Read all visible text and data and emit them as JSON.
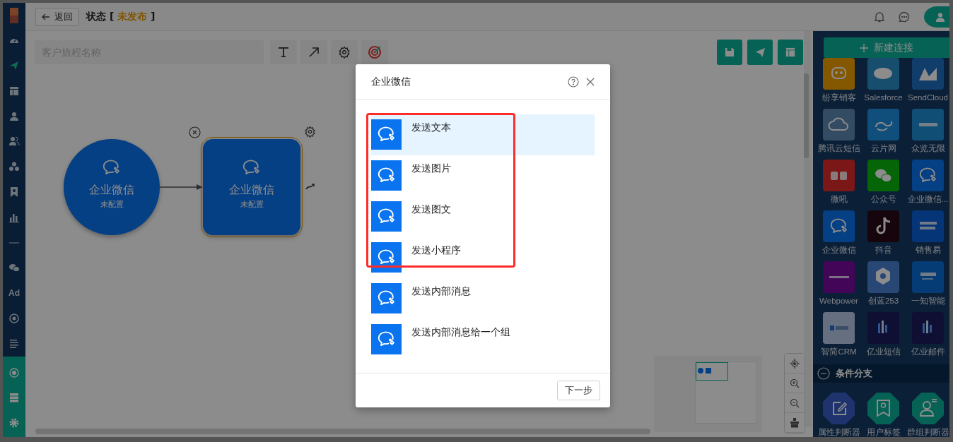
{
  "top_bar": {
    "back_button": "返回",
    "status_label": "状态",
    "bracket_open": "[",
    "status_value": "未发布",
    "bracket_close": "]"
  },
  "left_nav": {
    "top_items": [
      {
        "selected": false
      },
      {
        "selected": true
      },
      {
        "selected": false
      },
      {
        "selected": false
      },
      {
        "selected": false
      },
      {
        "selected": false
      },
      {
        "selected": false
      },
      {
        "selected": false
      },
      {
        "selected": false
      },
      {
        "selected": false
      },
      {
        "selected": false,
        "label": "Ad"
      },
      {
        "selected": false
      },
      {
        "selected": false
      }
    ],
    "bottom_items": [
      {
        "selected": false
      },
      {
        "selected": false
      },
      {
        "selected": false
      }
    ]
  },
  "toolbar": {
    "name_field": {
      "placeholder": "客户旅程名称"
    }
  },
  "canvas": {
    "nodes": [
      {
        "kind": "circle",
        "title": "企业微信",
        "subtitle": "未配置",
        "selected": false
      },
      {
        "kind": "square",
        "title": "企业微信",
        "subtitle": "未配置",
        "selected": true
      }
    ]
  },
  "right_panel": {
    "new_connection_button": "新建连接",
    "apps": [
      {
        "name": "纷享销客"
      },
      {
        "name": "Salesforce"
      },
      {
        "name": "SendCloud"
      },
      {
        "name": "腾讯云短信"
      },
      {
        "name": "云片网"
      },
      {
        "name": "众览无限"
      },
      {
        "name": "微吼"
      },
      {
        "name": "公众号"
      },
      {
        "name": "企业微信..."
      },
      {
        "name": "企业微信"
      },
      {
        "name": "抖音"
      },
      {
        "name": "销售易"
      },
      {
        "name": "Webpower"
      },
      {
        "name": "创蓝253"
      },
      {
        "name": "一知智能"
      },
      {
        "name": "智简CRM"
      },
      {
        "name": "亿业短信"
      },
      {
        "name": "亿业邮件"
      }
    ],
    "section": {
      "title": "条件分支",
      "expanded": true
    },
    "conditions": [
      {
        "name": "属性判断器"
      },
      {
        "name": "用户标签"
      },
      {
        "name": "群组判断器"
      }
    ]
  },
  "dialog": {
    "title": "企业微信",
    "items": [
      {
        "label": "发送文本",
        "selected": true
      },
      {
        "label": "发送图片",
        "selected": false
      },
      {
        "label": "发送图文",
        "selected": false
      },
      {
        "label": "发送小程序",
        "selected": false
      },
      {
        "label": "发送内部消息",
        "selected": false
      },
      {
        "label": "发送内部消息给一个组",
        "selected": false
      }
    ],
    "next_button": "下一步"
  }
}
